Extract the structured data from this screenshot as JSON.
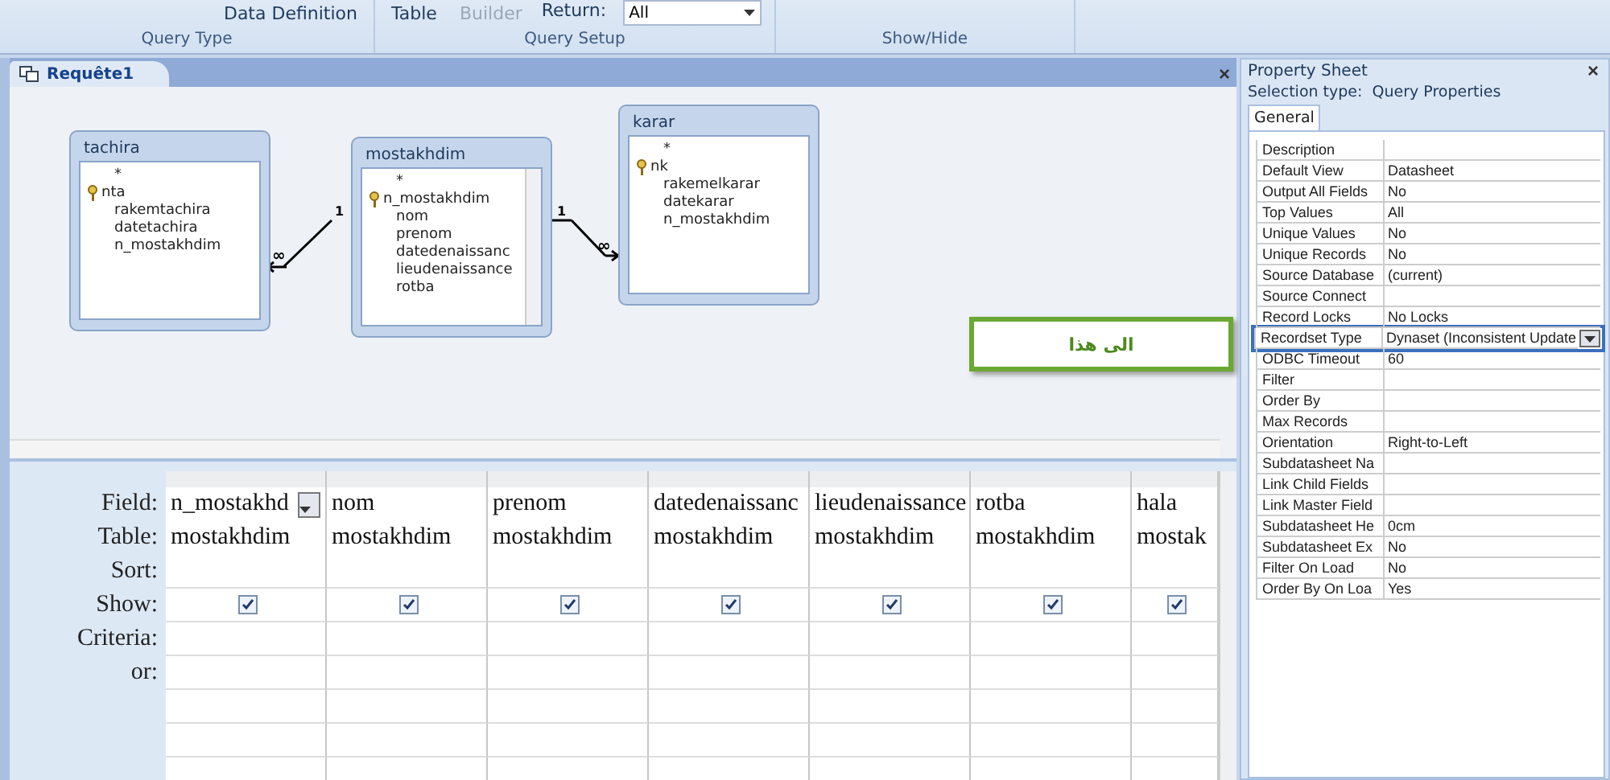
{
  "ribbon": {
    "groups": [
      {
        "label": "Query Type",
        "items": [
          {
            "kind": "button",
            "label": "Data Definition",
            "disabled": false
          }
        ]
      },
      {
        "label": "Query Setup",
        "items": [
          {
            "kind": "button",
            "label": "Table",
            "disabled": false
          },
          {
            "kind": "button",
            "label": "Builder",
            "disabled": true
          },
          {
            "kind": "combo",
            "label": "Return:",
            "value": "All"
          }
        ]
      },
      {
        "label": "Show/Hide"
      }
    ]
  },
  "document_tab": {
    "title": "Requête1",
    "close": "×"
  },
  "design": {
    "tables": [
      {
        "name": "tachira",
        "fields": [
          {
            "name": "*",
            "key": false
          },
          {
            "name": "nta",
            "key": true
          },
          {
            "name": "rakemtachira",
            "key": false
          },
          {
            "name": "datetachira",
            "key": false
          },
          {
            "name": "n_mostakhdim",
            "key": false
          }
        ]
      },
      {
        "name": "mostakhdim",
        "fields": [
          {
            "name": "*",
            "key": false
          },
          {
            "name": "n_mostakhdim",
            "key": true
          },
          {
            "name": "nom",
            "key": false
          },
          {
            "name": "prenom",
            "key": false
          },
          {
            "name": "datedenaissanc",
            "key": false
          },
          {
            "name": "lieudenaissance",
            "key": false
          },
          {
            "name": "rotba",
            "key": false
          }
        ]
      },
      {
        "name": "karar",
        "fields": [
          {
            "name": "*",
            "key": false
          },
          {
            "name": "nk",
            "key": true
          },
          {
            "name": "rakemelkarar",
            "key": false
          },
          {
            "name": "datekarar",
            "key": false
          },
          {
            "name": "n_mostakhdim",
            "key": false
          }
        ]
      }
    ],
    "relationships": [
      {
        "one_label": "1",
        "many_label": "∞"
      },
      {
        "one_label": "1",
        "many_label": "∞"
      }
    ],
    "callout": {
      "text": "الى هذا"
    }
  },
  "grid": {
    "row_labels": [
      "Field:",
      "Table:",
      "Sort:",
      "Show:",
      "Criteria:",
      "or:"
    ],
    "columns": [
      {
        "field": "n_mostakhd",
        "table": "mostakhdim",
        "show": true,
        "selected": true
      },
      {
        "field": "nom",
        "table": "mostakhdim",
        "show": true,
        "selected": false
      },
      {
        "field": "prenom",
        "table": "mostakhdim",
        "show": true,
        "selected": false
      },
      {
        "field": "datedenaissanc",
        "table": "mostakhdim",
        "show": true,
        "selected": false
      },
      {
        "field": "lieudenaissance",
        "table": "mostakhdim",
        "show": true,
        "selected": false
      },
      {
        "field": "rotba",
        "table": "mostakhdim",
        "show": true,
        "selected": false
      },
      {
        "field": "hala",
        "table": "mostak",
        "show": true,
        "selected": false
      }
    ]
  },
  "property_sheet": {
    "title": "Property Sheet",
    "close": "×",
    "selection_label": "Selection type:",
    "selection_value": "Query Properties",
    "tab": "General",
    "rows": [
      {
        "label": "Description",
        "value": "",
        "selected": false
      },
      {
        "label": "Default View",
        "value": "Datasheet",
        "selected": false
      },
      {
        "label": "Output All Fields",
        "value": "No",
        "selected": false
      },
      {
        "label": "Top Values",
        "value": "All",
        "selected": false
      },
      {
        "label": "Unique Values",
        "value": "No",
        "selected": false
      },
      {
        "label": "Unique Records",
        "value": "No",
        "selected": false
      },
      {
        "label": "Source Database",
        "value": "(current)",
        "selected": false
      },
      {
        "label": "Source Connect",
        "value": "",
        "selected": false
      },
      {
        "label": "Record Locks",
        "value": "No Locks",
        "selected": false
      },
      {
        "label": "Recordset Type",
        "value": "Dynaset (Inconsistent Update",
        "selected": true
      },
      {
        "label": "ODBC Timeout",
        "value": "60",
        "selected": false
      },
      {
        "label": "Filter",
        "value": "",
        "selected": false
      },
      {
        "label": "Order By",
        "value": "",
        "selected": false
      },
      {
        "label": "Max Records",
        "value": "",
        "selected": false
      },
      {
        "label": "Orientation",
        "value": "Right-to-Left",
        "selected": false
      },
      {
        "label": "Subdatasheet Na",
        "value": "",
        "selected": false
      },
      {
        "label": "Link Child Fields",
        "value": "",
        "selected": false
      },
      {
        "label": "Link Master Field",
        "value": "",
        "selected": false
      },
      {
        "label": "Subdatasheet He",
        "value": "0cm",
        "selected": false
      },
      {
        "label": "Subdatasheet Ex",
        "value": "No",
        "selected": false
      },
      {
        "label": "Filter On Load",
        "value": "No",
        "selected": false
      },
      {
        "label": "Order By On Loa",
        "value": "Yes",
        "selected": false
      }
    ]
  }
}
